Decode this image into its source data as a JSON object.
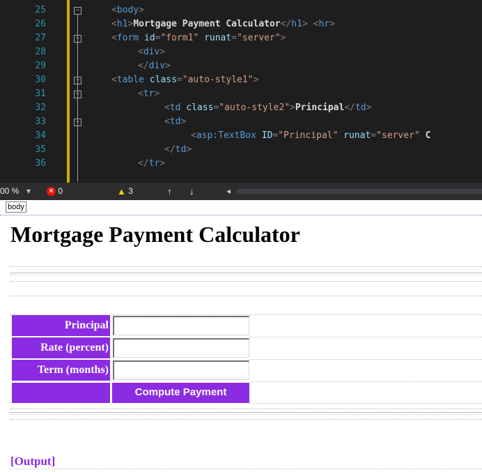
{
  "editor": {
    "lines": [
      {
        "num": "25",
        "indent": 0,
        "tokens": [
          [
            "brk",
            "<"
          ],
          [
            "tag",
            "body"
          ],
          [
            "brk",
            ">"
          ]
        ]
      },
      {
        "num": "26",
        "indent": 0,
        "tokens": [
          [
            "brk",
            "<"
          ],
          [
            "tag",
            "h1"
          ],
          [
            "brk",
            ">"
          ],
          [
            "txt",
            "Mortgage Payment Calculator"
          ],
          [
            "brk",
            "</"
          ],
          [
            "tag",
            "h1"
          ],
          [
            "brk",
            "> <"
          ],
          [
            "tag",
            "hr"
          ],
          [
            "brk",
            ">"
          ]
        ]
      },
      {
        "num": "27",
        "indent": 0,
        "tokens": [
          [
            "brk",
            "<"
          ],
          [
            "tag",
            "form"
          ],
          [
            "txt",
            " "
          ],
          [
            "attr",
            "id"
          ],
          [
            "brk",
            "="
          ],
          [
            "aval",
            "\"form1\""
          ],
          [
            "txt",
            " "
          ],
          [
            "attr",
            "runat"
          ],
          [
            "brk",
            "="
          ],
          [
            "aval",
            "\"server\""
          ],
          [
            "brk",
            ">"
          ]
        ]
      },
      {
        "num": "28",
        "indent": 1,
        "tokens": [
          [
            "brk",
            "<"
          ],
          [
            "tag",
            "div"
          ],
          [
            "brk",
            ">"
          ]
        ]
      },
      {
        "num": "29",
        "indent": 1,
        "tokens": [
          [
            "brk",
            "</"
          ],
          [
            "tag",
            "div"
          ],
          [
            "brk",
            ">"
          ]
        ]
      },
      {
        "num": "30",
        "indent": 0,
        "tokens": [
          [
            "brk",
            "<"
          ],
          [
            "tag",
            "table"
          ],
          [
            "txt",
            " "
          ],
          [
            "attr",
            "class"
          ],
          [
            "brk",
            "="
          ],
          [
            "aval",
            "\"auto-style1\""
          ],
          [
            "brk",
            ">"
          ]
        ]
      },
      {
        "num": "31",
        "indent": 1,
        "tokens": [
          [
            "brk",
            "<"
          ],
          [
            "tag",
            "tr"
          ],
          [
            "brk",
            ">"
          ]
        ]
      },
      {
        "num": "32",
        "indent": 2,
        "tokens": [
          [
            "brk",
            "<"
          ],
          [
            "tag",
            "td"
          ],
          [
            "txt",
            " "
          ],
          [
            "attr",
            "class"
          ],
          [
            "brk",
            "="
          ],
          [
            "aval",
            "\"auto-style2\""
          ],
          [
            "brk",
            ">"
          ],
          [
            "txt",
            "Principal"
          ],
          [
            "brk",
            "</"
          ],
          [
            "tag",
            "td"
          ],
          [
            "brk",
            ">"
          ]
        ]
      },
      {
        "num": "33",
        "indent": 2,
        "tokens": [
          [
            "brk",
            "<"
          ],
          [
            "tag",
            "td"
          ],
          [
            "brk",
            ">"
          ]
        ]
      },
      {
        "num": "34",
        "indent": 3,
        "tokens": [
          [
            "brk",
            "<"
          ],
          [
            "tag",
            "asp:TextBox"
          ],
          [
            "txt",
            " "
          ],
          [
            "attr",
            "ID"
          ],
          [
            "brk",
            "="
          ],
          [
            "aval",
            "\"Principal\""
          ],
          [
            "txt",
            " "
          ],
          [
            "attr",
            "runat"
          ],
          [
            "brk",
            "="
          ],
          [
            "aval",
            "\"server\""
          ],
          [
            "txt",
            " C"
          ]
        ]
      },
      {
        "num": "35",
        "indent": 2,
        "tokens": [
          [
            "brk",
            "</"
          ],
          [
            "tag",
            "td"
          ],
          [
            "brk",
            ">"
          ]
        ]
      },
      {
        "num": "36",
        "indent": 1,
        "tokens": [
          [
            "brk",
            "</"
          ],
          [
            "tag",
            "tr"
          ],
          [
            "brk",
            ">"
          ]
        ]
      }
    ]
  },
  "statusbar": {
    "zoom": "00 %",
    "errors": "0",
    "warnings": "3"
  },
  "tag_strip": {
    "current_tag": "body"
  },
  "page": {
    "title": "Mortgage Payment Calculator",
    "form": {
      "rows": [
        {
          "label": "Principal",
          "value": ""
        },
        {
          "label": "Rate (percent)",
          "value": ""
        },
        {
          "label": "Term (months)",
          "value": ""
        }
      ],
      "compute_button": "Compute Payment"
    },
    "output": "[Output]"
  },
  "colors": {
    "accent_purple": "#8b2be2",
    "editor_bg": "#1e1e1e",
    "tag_blue": "#569cd6",
    "attr_lightblue": "#9cdcfe",
    "value_salmon": "#d69d85"
  }
}
